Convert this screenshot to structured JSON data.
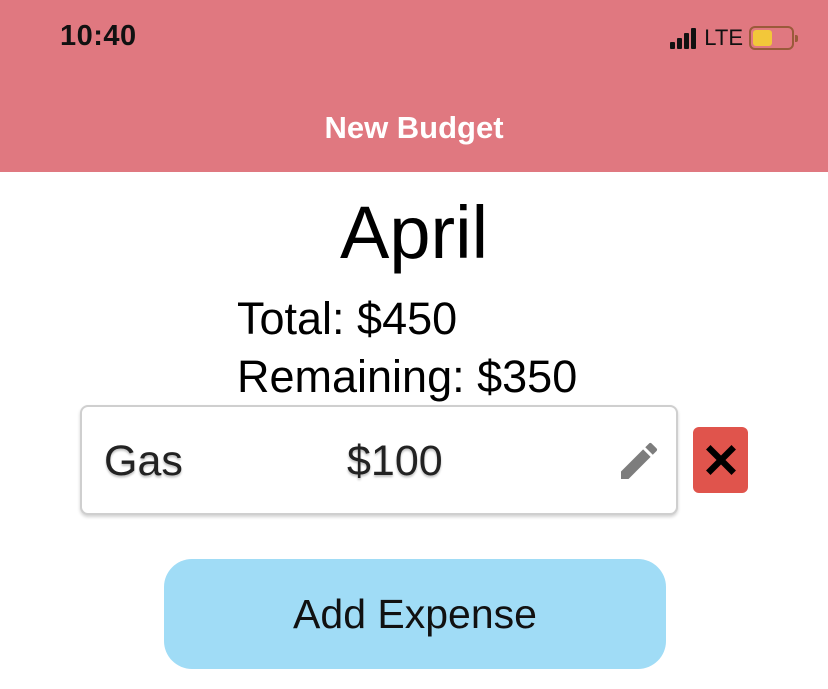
{
  "status_bar": {
    "time": "10:40",
    "network": "LTE",
    "battery_level": 0.5
  },
  "header": {
    "title": "New Budget",
    "background_color": "#e07880"
  },
  "budget": {
    "month": "April",
    "total_text": "Total: $450",
    "remaining_text": "Remaining: $350"
  },
  "expenses": [
    {
      "name": "Gas",
      "amount": "$100",
      "edit_icon": "pencil-icon",
      "delete_icon": "close-icon"
    }
  ],
  "actions": {
    "add_expense_label": "Add Expense"
  },
  "colors": {
    "delete": "#e0544c",
    "add_button": "#a0dcf6"
  }
}
